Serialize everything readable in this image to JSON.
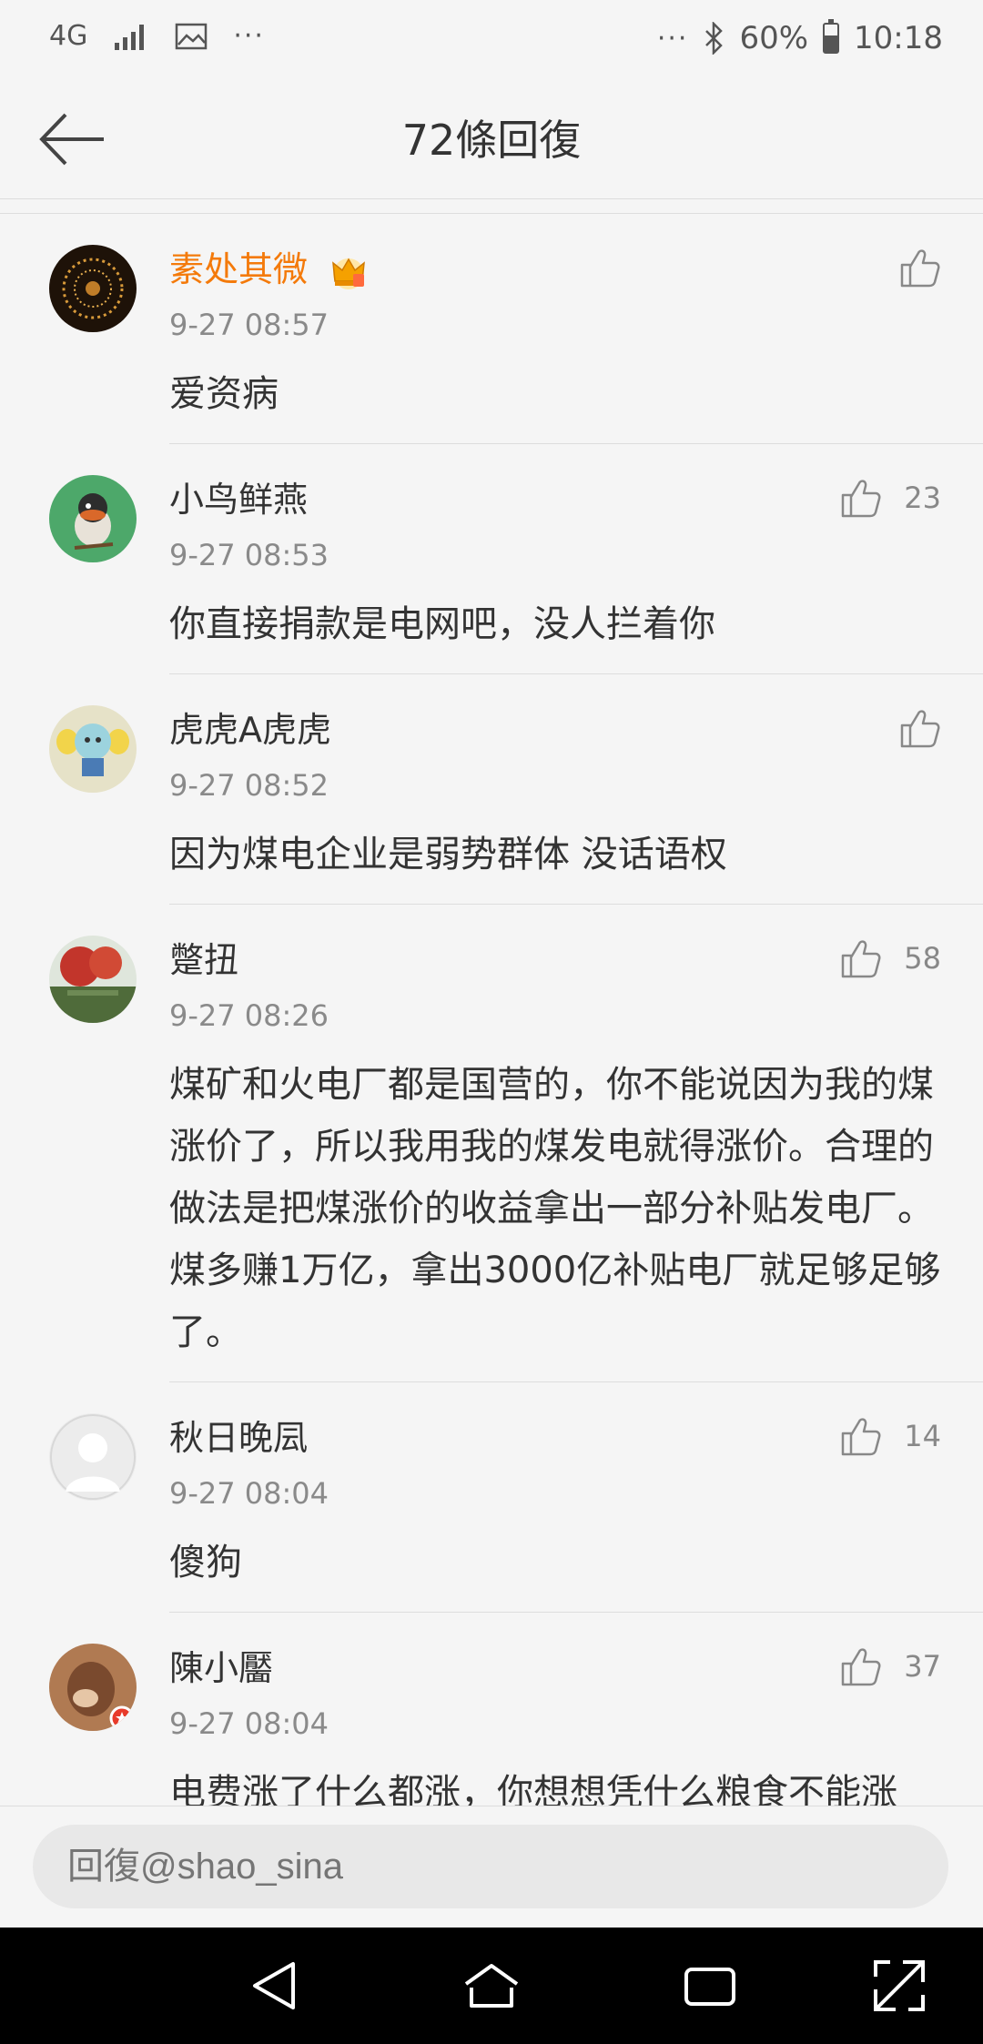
{
  "status_bar": {
    "network": "4G",
    "dots_left": "···",
    "dots_right": "···",
    "battery": "60%",
    "battery_level": 0.6,
    "time": "10:18"
  },
  "header": {
    "title": "72條回復"
  },
  "comments": [
    {
      "username": "素处其微",
      "vip": true,
      "time": "9-27 08:57",
      "text": "爱资病",
      "likes": ""
    },
    {
      "username": "小鸟鲜燕",
      "vip": false,
      "time": "9-27 08:53",
      "text": "你直接捐款是电网吧，没人拦着你",
      "likes": "23"
    },
    {
      "username": "虎虎A虎虎",
      "vip": false,
      "time": "9-27 08:52",
      "text": "因为煤电企业是弱势群体 没话语权",
      "likes": ""
    },
    {
      "username": "蹩扭",
      "vip": false,
      "time": "9-27 08:26",
      "text": "煤矿和火电厂都是国营的，你不能说因为我的煤涨价了，所以我用我的煤发电就得涨价。合理的做法是把煤涨价的收益拿出一部分补贴发电厂。煤多赚1万亿，拿出3000亿补贴电厂就足够足够了。",
      "likes": "58"
    },
    {
      "username": "秋日晚凨",
      "vip": false,
      "time": "9-27 08:04",
      "text": "傻狗",
      "likes": "14"
    },
    {
      "username": "陳小靨",
      "vip": false,
      "time": "9-27 08:04",
      "text": "电费涨了什么都涨，你想想凭什么粮食不能涨",
      "likes": "37"
    }
  ],
  "reply": {
    "placeholder": "回復@shao_sina"
  },
  "icons": {
    "back": "arrow-left-icon",
    "like": "thumbs-up-icon",
    "nav_back": "triangle-back-icon",
    "nav_home": "home-icon",
    "nav_recent": "recent-apps-icon",
    "nav_expand": "expand-icon"
  },
  "colors": {
    "vip_name": "#f47a0a",
    "timestamp": "#8a8a8a",
    "background": "#f5f5f5"
  }
}
